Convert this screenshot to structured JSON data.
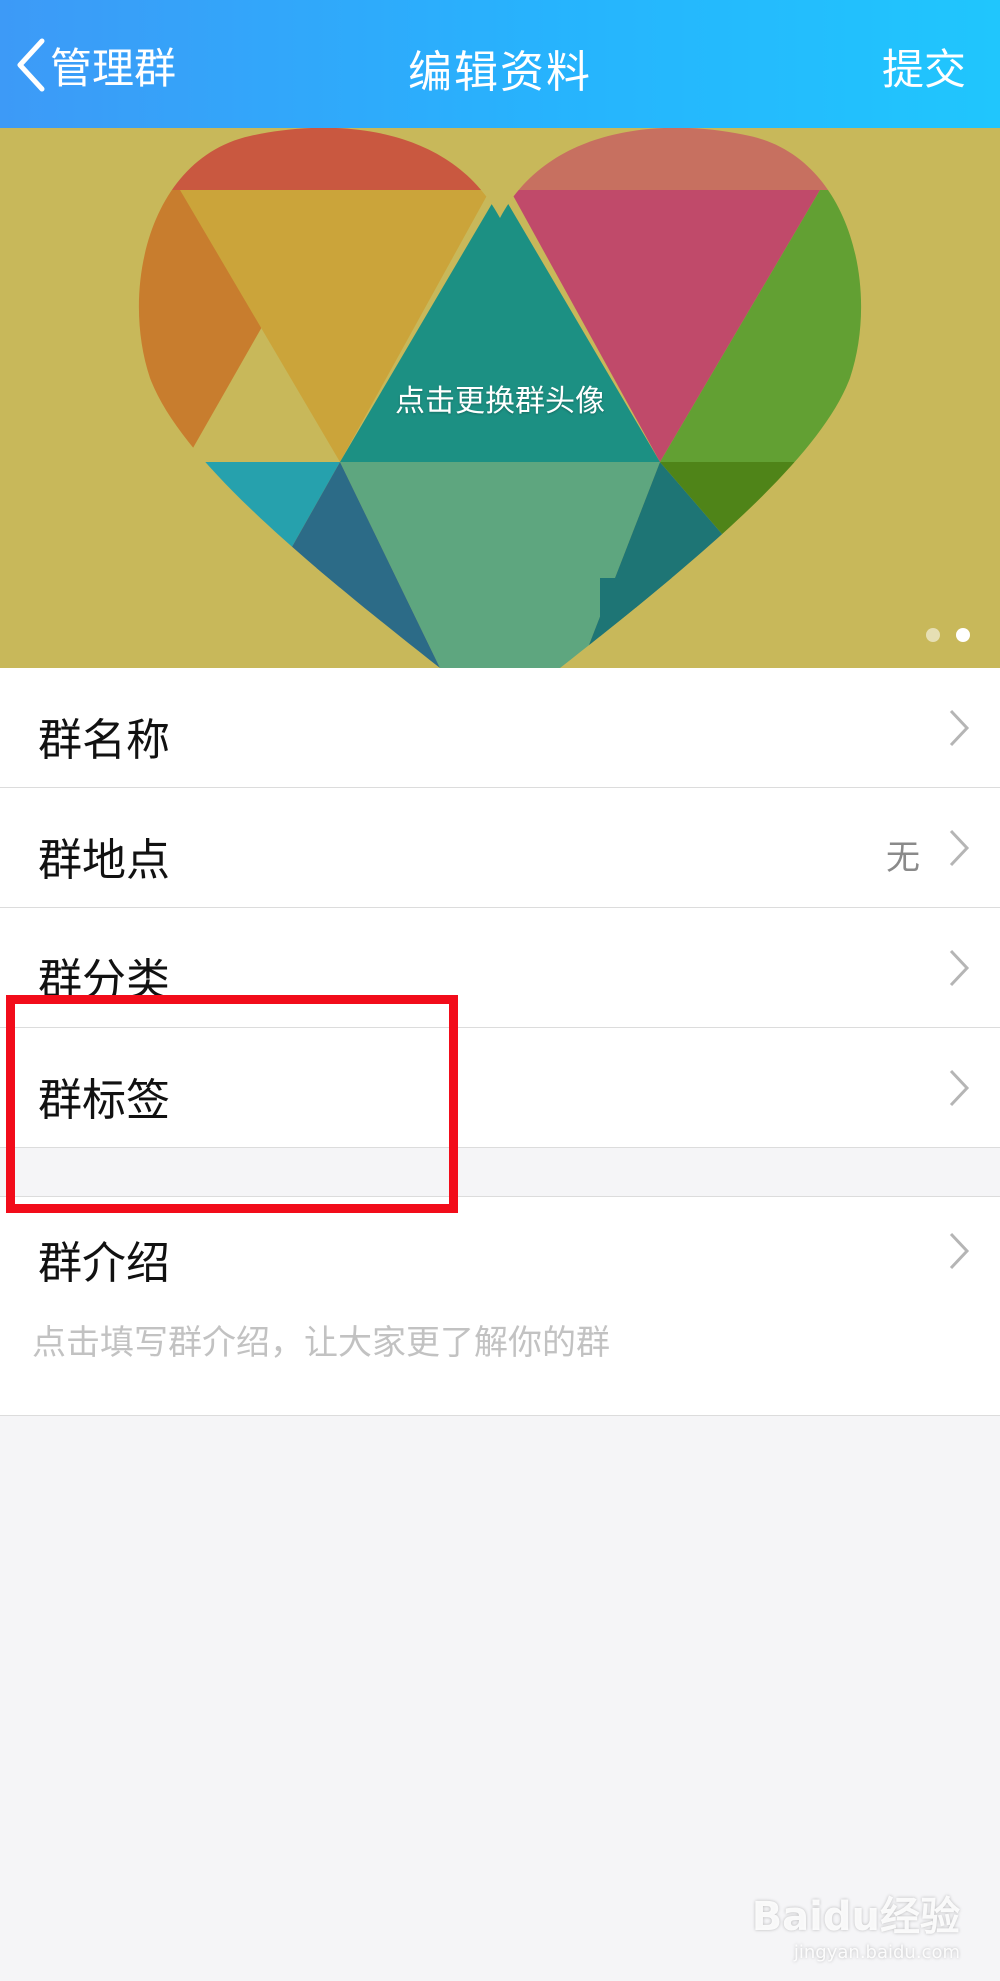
{
  "navbar": {
    "back_label": "管理群",
    "title": "编辑资料",
    "submit_label": "提交"
  },
  "banner": {
    "hint": "点击更换群头像",
    "page_count": 2,
    "active_page": 2
  },
  "settings": {
    "rows": [
      {
        "label": "群名称",
        "value": ""
      },
      {
        "label": "群地点",
        "value": "无"
      },
      {
        "label": "群分类",
        "value": ""
      },
      {
        "label": "群标签",
        "value": ""
      }
    ],
    "intro": {
      "label": "群介绍",
      "placeholder": "点击填写群介绍，让大家更了解你的群"
    }
  },
  "annotation": {
    "highlight_color": "#f20c1a"
  },
  "watermark": {
    "main": "Baidu经验",
    "sub": "jingyan.baidu.com"
  },
  "colors": {
    "navbar_start": "#3d9af7",
    "navbar_end": "#20c6fd",
    "banner_bg": "#c8b85a"
  }
}
